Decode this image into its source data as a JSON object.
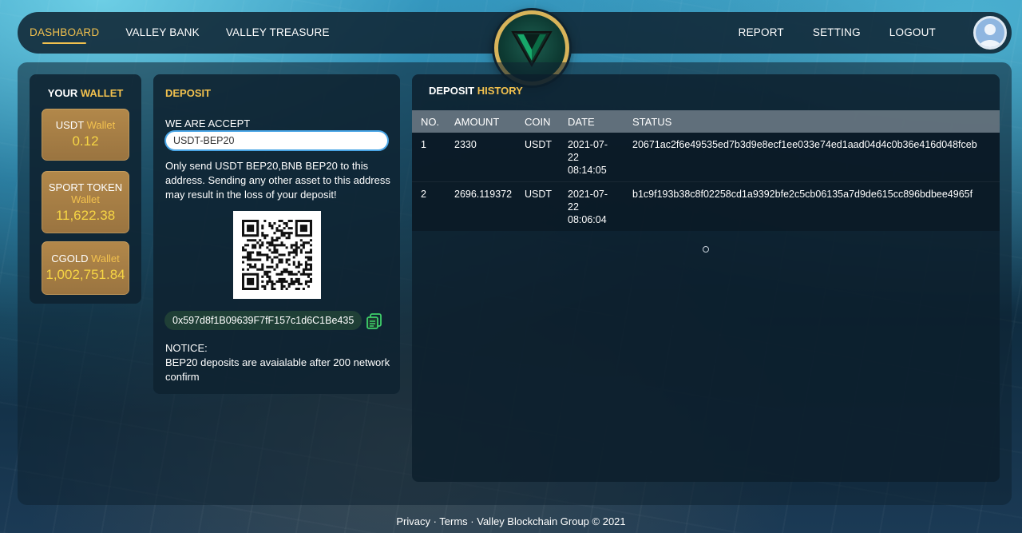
{
  "nav": {
    "left": [
      "DASHBOARD",
      "VALLEY BANK",
      "VALLEY TREASURE"
    ],
    "right": [
      "REPORT",
      "SETTING",
      "LOGOUT"
    ],
    "logo_icon": "valley-v-logo",
    "avatar_icon": "user-avatar-icon"
  },
  "wallet": {
    "title_a": "YOUR",
    "title_b": "WALLET",
    "items": [
      {
        "name": "USDT",
        "sub": "Wallet",
        "value": "0.12"
      },
      {
        "name": "SPORT TOKEN",
        "sub": "Wallet",
        "value": "11,622.38"
      },
      {
        "name": "CGOLD",
        "sub": "Wallet",
        "value": "1,002,751.84"
      }
    ]
  },
  "deposit": {
    "title": "DEPOSIT",
    "accept_label": "WE ARE ACCEPT",
    "selected_coin": "USDT-BEP20",
    "note": "Only send USDT BEP20,BNB BEP20 to this address. Sending any other asset to this address may result in the loss of your deposit!",
    "address": "0x597d8f1B09639F7fF157c1d6C1Be435",
    "notice_title": "NOTICE:",
    "notice_text": "BEP20 deposits are avaialable after 200 network confirm"
  },
  "history": {
    "title_a": "DEPOSIT",
    "title_b": "HISTORY",
    "columns": [
      "NO.",
      "AMOUNT",
      "COIN",
      "DATE",
      "STATUS"
    ],
    "rows": [
      {
        "no": "1",
        "amount": "2330",
        "coin": "USDT",
        "date_a": "2021-07-",
        "date_b": "22",
        "date_c": "08:14:05",
        "status": "20671ac2f6e49535ed7b3d9e8ecf1ee033e74ed1aad04d4c0b36e416d048fceb"
      },
      {
        "no": "2",
        "amount": "2696.119372",
        "coin": "USDT",
        "date_a": "2021-07-",
        "date_b": "22",
        "date_c": "08:06:04",
        "status": "b1c9f193b38c8f02258cd1a9392bfe2c5cb06135a7d9de615cc896bdbee4965f"
      }
    ]
  },
  "footer": {
    "privacy": "Privacy",
    "terms": "Terms",
    "company": "Valley Blockchain Group © 2021",
    "sep": " · "
  },
  "colors": {
    "accent": "#f2c14e",
    "wallet_box": "#a77f45",
    "value_yellow": "#f6d544",
    "input_border": "#4aa6e6"
  }
}
